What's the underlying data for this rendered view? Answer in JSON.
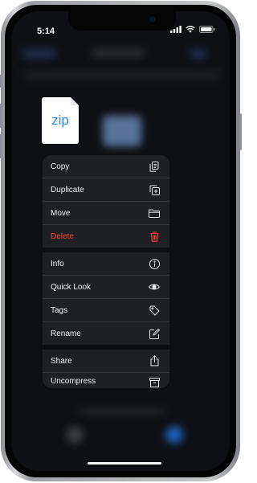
{
  "status_bar": {
    "time": "5:14",
    "icons": [
      "signal-icon",
      "wifi-icon",
      "battery-icon"
    ]
  },
  "file": {
    "extension": "zip",
    "icon": "zip-file-icon"
  },
  "context_menu": {
    "items": [
      {
        "label": "Copy",
        "icon": "copy-icon",
        "destructive": false
      },
      {
        "label": "Duplicate",
        "icon": "duplicate-icon",
        "destructive": false
      },
      {
        "label": "Move",
        "icon": "folder-icon",
        "destructive": false
      },
      {
        "label": "Delete",
        "icon": "trash-icon",
        "destructive": true
      },
      {
        "label": "Info",
        "icon": "info-icon",
        "destructive": false
      },
      {
        "label": "Quick Look",
        "icon": "eye-icon",
        "destructive": false
      },
      {
        "label": "Tags",
        "icon": "tag-icon",
        "destructive": false
      },
      {
        "label": "Rename",
        "icon": "rename-icon",
        "destructive": false
      },
      {
        "label": "Share",
        "icon": "share-icon",
        "destructive": false
      },
      {
        "label": "Uncompress",
        "icon": "archive-icon",
        "destructive": false
      }
    ]
  },
  "colors": {
    "menu_background": "#1f2023",
    "destructive": "#ff453a",
    "file_extension": "#2f88e6",
    "dock_accent": "#1e5fb8"
  }
}
